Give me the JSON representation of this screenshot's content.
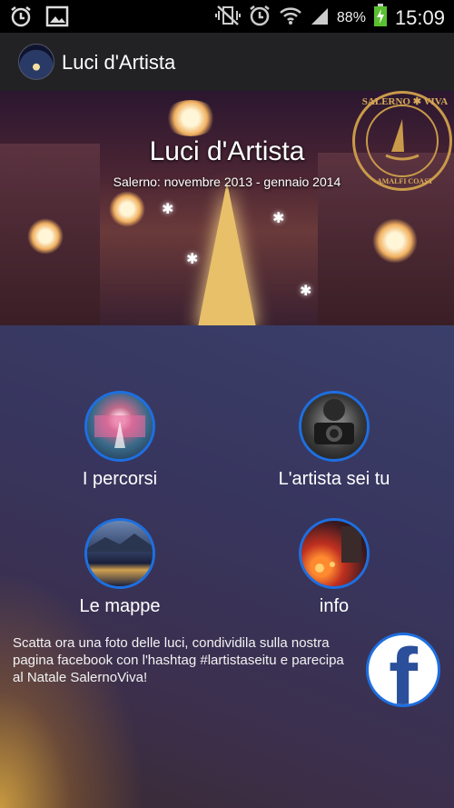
{
  "status_bar": {
    "icons_left": [
      "alarm-icon",
      "image-icon"
    ],
    "icons_right": [
      "vibrate-off-icon",
      "alarm-clock-icon",
      "wifi-icon",
      "signal-icon",
      "battery-charging-icon"
    ],
    "battery_percent": "88%",
    "time": "15:09"
  },
  "action_bar": {
    "title": "Luci d'Artista"
  },
  "hero": {
    "title": "Luci d'Artista",
    "subtitle": "Salerno: novembre 2013 - gennaio 2014",
    "seal": {
      "top": "SALERNO ✱ VIVA",
      "bottom": "AMALFI COAST"
    }
  },
  "menu": {
    "items": [
      {
        "label": "I percorsi",
        "image": "illuminated-square-photo"
      },
      {
        "label": "L'artista sei tu",
        "image": "photographer-photo"
      },
      {
        "label": "Le mappe",
        "image": "city-night-map-photo"
      },
      {
        "label": "info",
        "image": "night-street-photo"
      }
    ],
    "promo_text": "Scatta ora una foto delle luci, condividila sulla nostra pagina facebook con l'hashtag #lartistaseitu e parecipa al Natale SalernoViva!",
    "facebook_glyph": "f"
  },
  "colors": {
    "accent_ring": "#1e6fe0",
    "action_bar": "#222225",
    "status_bar": "#000000",
    "facebook": "#2b4f9a"
  }
}
